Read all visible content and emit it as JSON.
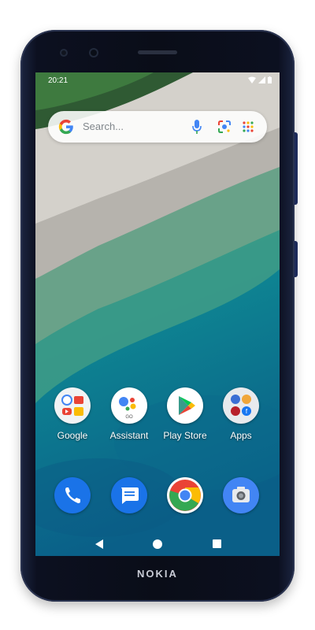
{
  "device": {
    "brand": "NOKIA"
  },
  "status_bar": {
    "time": "20:21"
  },
  "search": {
    "placeholder": "Search..."
  },
  "home_apps": [
    {
      "label": "Google",
      "icon": "google-folder-icon"
    },
    {
      "label": "Assistant",
      "icon": "assistant-icon"
    },
    {
      "label": "Play Store",
      "icon": "play-store-icon"
    },
    {
      "label": "Apps",
      "icon": "apps-folder-icon"
    }
  ],
  "dock": [
    {
      "icon": "phone-icon",
      "color": "#1a73e8"
    },
    {
      "icon": "messages-icon",
      "color": "#1a73e8"
    },
    {
      "icon": "chrome-icon"
    },
    {
      "icon": "camera-icon",
      "color": "#4285f4"
    }
  ],
  "colors": {
    "google_blue": "#4285F4",
    "google_red": "#EA4335",
    "google_yellow": "#FBBC05",
    "google_green": "#34A853"
  }
}
